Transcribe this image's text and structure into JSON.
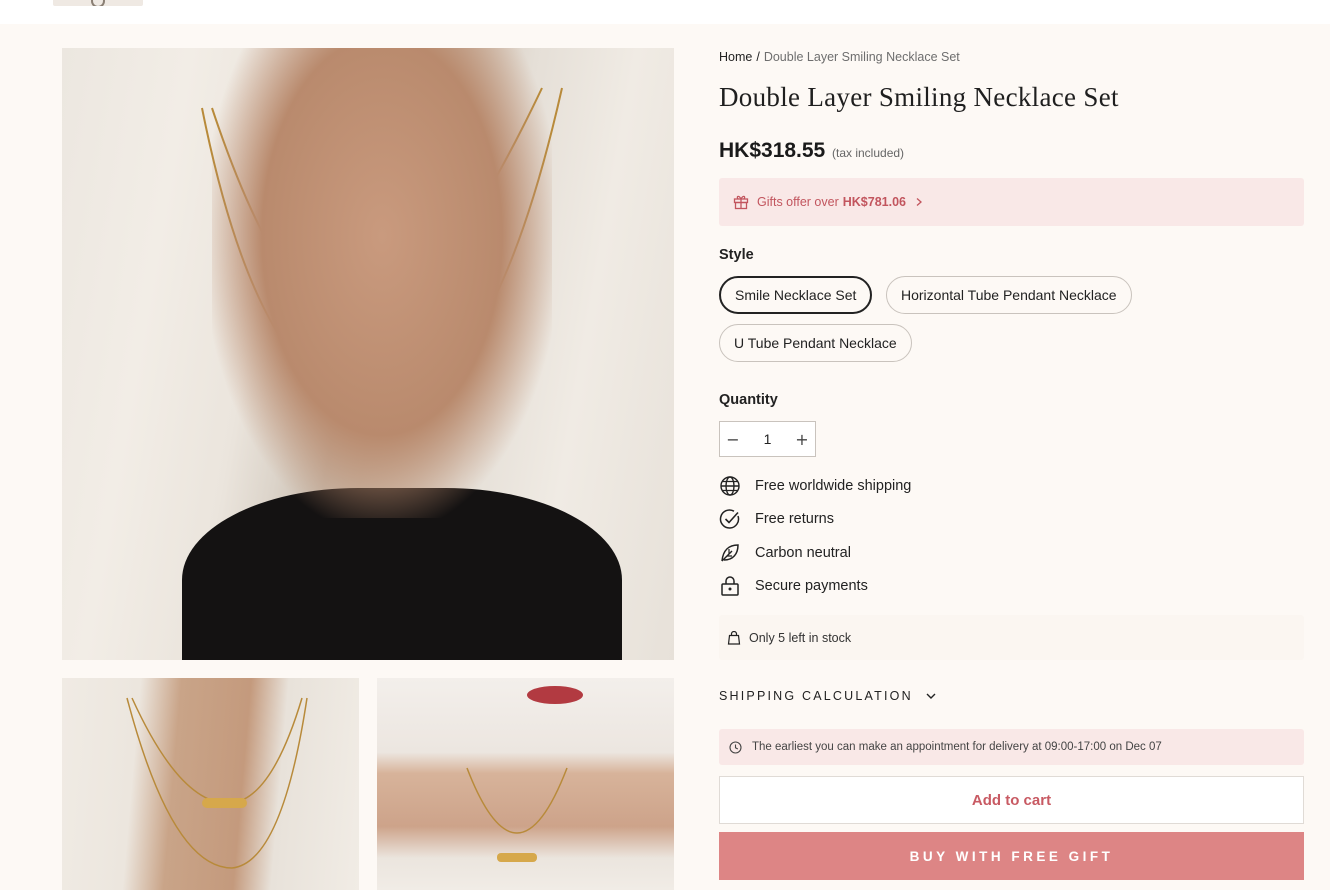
{
  "breadcrumb": {
    "home": "Home",
    "separator": "/",
    "current": "Double Layer Smiling Necklace Set"
  },
  "product": {
    "title": "Double Layer Smiling Necklace Set",
    "price": "HK$318.55",
    "tax_note": "(tax included)"
  },
  "gift_offer": {
    "text": "Gifts offer over",
    "amount": "HK$781.06",
    "icon": "gift-icon"
  },
  "style": {
    "label": "Style",
    "options": [
      "Smile Necklace Set",
      "Horizontal Tube Pendant Necklace",
      "U Tube Pendant Necklace"
    ],
    "selected": "Smile Necklace Set"
  },
  "quantity": {
    "label": "Quantity",
    "value": "1",
    "minus": "−",
    "plus": "+"
  },
  "features": [
    {
      "icon": "globe-icon",
      "label": "Free worldwide shipping"
    },
    {
      "icon": "check-circle-icon",
      "label": "Free returns"
    },
    {
      "icon": "leaf-icon",
      "label": "Carbon neutral"
    },
    {
      "icon": "lock-icon",
      "label": "Secure payments"
    }
  ],
  "stock": {
    "icon": "bag-icon",
    "text": "Only 5 left in stock"
  },
  "shipping": {
    "label": "SHIPPING CALCULATION",
    "delivery_note": "The earliest you can make an appointment for delivery at 09:00-17:00 on Dec 07"
  },
  "actions": {
    "add_to_cart": "Add to cart",
    "buy_gift": "BUY WITH FREE GIFT"
  },
  "colors": {
    "accent": "#c2555e",
    "pink_bg": "#f9e8e7",
    "buy_button": "#dd8585",
    "page_bg": "#fdf9f5"
  }
}
